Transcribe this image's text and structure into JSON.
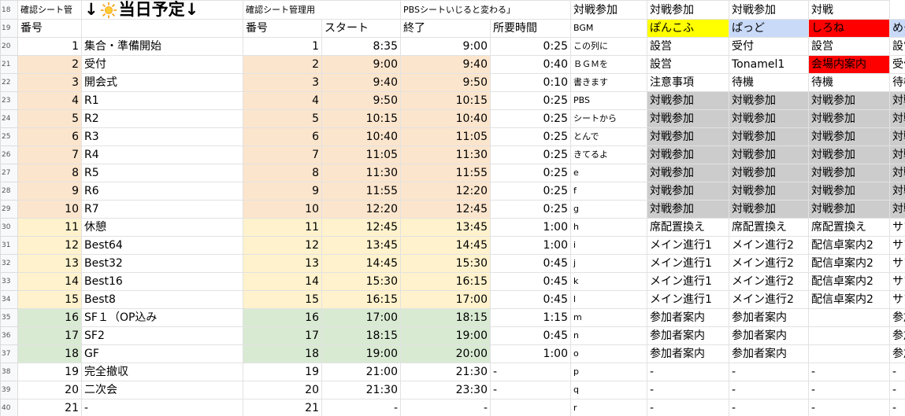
{
  "row_numbers": [
    "18",
    "19",
    "20",
    "21",
    "22",
    "23",
    "24",
    "25",
    "26",
    "27",
    "28",
    "29",
    "30",
    "31",
    "32",
    "33",
    "34",
    "35",
    "36",
    "37",
    "38",
    "39",
    "40"
  ],
  "header1": {
    "a": "確認シート管",
    "title_left_arrow": "↓",
    "title_text": "当日予定",
    "title_right_arrow": "↓",
    "c": "確認シート管理用",
    "f": "PBSシートいじると変わる」",
    "h": "対戦参加",
    "i": "対戦参加",
    "j": "対戦参加",
    "k": "対戦"
  },
  "header2": {
    "a": "番号",
    "c": "番号",
    "d": "スタート",
    "e": "終了",
    "f": "所要時間",
    "g": "BGM",
    "h": "ぽんこふ",
    "i": "ぱっど",
    "j": "しろね",
    "k": "めー"
  },
  "colors": {
    "peach": "#fce5cd",
    "cream": "#fff2cc",
    "green": "#d9ead3",
    "gray": "#cccccc",
    "yellow": "#ffff00",
    "blue": "#c9daf8",
    "red": "#ff0000"
  },
  "rows": [
    {
      "no": "1",
      "name": "集合・準備開始",
      "no2": "1",
      "start": "8:35",
      "end": "9:00",
      "dur": "0:25",
      "bgm": "この列に",
      "h": "設営",
      "i": "受付",
      "j": "設営",
      "k": "設営"
    },
    {
      "no": "2",
      "name": "受付",
      "no2": "2",
      "start": "9:00",
      "end": "9:40",
      "dur": "0:40",
      "bgm": "ＢＧＭを",
      "h": "設営",
      "i": "Tonamel1",
      "j": "会場内案内",
      "k": "受付"
    },
    {
      "no": "3",
      "name": "開会式",
      "no2": "3",
      "start": "9:40",
      "end": "9:50",
      "dur": "0:10",
      "bgm": "書きます",
      "h": "注意事項",
      "i": "待機",
      "j": "待機",
      "k": "待機"
    },
    {
      "no": "4",
      "name": "R1",
      "no2": "4",
      "start": "9:50",
      "end": "10:15",
      "dur": "0:25",
      "bgm": "PBS",
      "h": "対戦参加",
      "i": "対戦参加",
      "j": "対戦参加",
      "k": "対戦"
    },
    {
      "no": "5",
      "name": "R2",
      "no2": "5",
      "start": "10:15",
      "end": "10:40",
      "dur": "0:25",
      "bgm": "シートから",
      "h": "対戦参加",
      "i": "対戦参加",
      "j": "対戦参加",
      "k": "対戦"
    },
    {
      "no": "6",
      "name": "R3",
      "no2": "6",
      "start": "10:40",
      "end": "11:05",
      "dur": "0:25",
      "bgm": "とんで",
      "h": "対戦参加",
      "i": "対戦参加",
      "j": "対戦参加",
      "k": "対戦"
    },
    {
      "no": "7",
      "name": "R4",
      "no2": "7",
      "start": "11:05",
      "end": "11:30",
      "dur": "0:25",
      "bgm": "きてるよ",
      "h": "対戦参加",
      "i": "対戦参加",
      "j": "対戦参加",
      "k": "対戦"
    },
    {
      "no": "8",
      "name": "R5",
      "no2": "8",
      "start": "11:30",
      "end": "11:55",
      "dur": "0:25",
      "bgm": "e",
      "h": "対戦参加",
      "i": "対戦参加",
      "j": "対戦参加",
      "k": "対戦"
    },
    {
      "no": "9",
      "name": "R6",
      "no2": "9",
      "start": "11:55",
      "end": "12:20",
      "dur": "0:25",
      "bgm": "f",
      "h": "対戦参加",
      "i": "対戦参加",
      "j": "対戦参加",
      "k": "対戦"
    },
    {
      "no": "10",
      "name": "R7",
      "no2": "10",
      "start": "12:20",
      "end": "12:45",
      "dur": "0:25",
      "bgm": "g",
      "h": "対戦参加",
      "i": "対戦参加",
      "j": "対戦参加",
      "k": "対戦"
    },
    {
      "no": "11",
      "name": "休憩",
      "no2": "11",
      "start": "12:45",
      "end": "13:45",
      "dur": "1:00",
      "bgm": "h",
      "h": "席配置換え",
      "i": "席配置換え",
      "j": "席配置換え",
      "k": "サブ"
    },
    {
      "no": "12",
      "name": "Best64",
      "no2": "12",
      "start": "13:45",
      "end": "14:45",
      "dur": "1:00",
      "bgm": "i",
      "h": "メイン進行1",
      "i": "メイン進行2",
      "j": "配信卓案内2",
      "k": "サブ"
    },
    {
      "no": "13",
      "name": "Best32",
      "no2": "13",
      "start": "14:45",
      "end": "15:30",
      "dur": "0:45",
      "bgm": "j",
      "h": "メイン進行1",
      "i": "メイン進行2",
      "j": "配信卓案内2",
      "k": "サブ"
    },
    {
      "no": "14",
      "name": "Best16",
      "no2": "14",
      "start": "15:30",
      "end": "16:15",
      "dur": "0:45",
      "bgm": "k",
      "h": "メイン進行1",
      "i": "メイン進行2",
      "j": "配信卓案内2",
      "k": "サブ"
    },
    {
      "no": "15",
      "name": "Best8",
      "no2": "15",
      "start": "16:15",
      "end": "17:00",
      "dur": "0:45",
      "bgm": "l",
      "h": "メイン進行1",
      "i": "メイン進行2",
      "j": "配信卓案内2",
      "k": "サブ"
    },
    {
      "no": "16",
      "name": "SF１（OP込み",
      "no2": "16",
      "start": "17:00",
      "end": "18:15",
      "dur": "1:15",
      "bgm": "m",
      "h": "参加者案内",
      "i": "参加者案内",
      "j": "",
      "k": "参加"
    },
    {
      "no": "17",
      "name": "SF2",
      "no2": "17",
      "start": "18:15",
      "end": "19:00",
      "dur": "0:45",
      "bgm": "n",
      "h": "参加者案内",
      "i": "参加者案内",
      "j": "",
      "k": "参加"
    },
    {
      "no": "18",
      "name": "GF",
      "no2": "18",
      "start": "19:00",
      "end": "20:00",
      "dur": "1:00",
      "bgm": "o",
      "h": "参加者案内",
      "i": "参加者案内",
      "j": "",
      "k": "参加"
    },
    {
      "no": "19",
      "name": "完全撤収",
      "no2": "19",
      "start": "21:00",
      "end": "21:30",
      "dur": "-",
      "bgm": "p",
      "h": "-",
      "i": "-",
      "j": "-",
      "k": "-"
    },
    {
      "no": "20",
      "name": "二次会",
      "no2": "20",
      "start": "21:30",
      "end": "23:30",
      "dur": "-",
      "bgm": "q",
      "h": "-",
      "i": "-",
      "j": "-",
      "k": "-"
    },
    {
      "no": "21",
      "name": "-",
      "no2": "21",
      "start": "-",
      "end": "-",
      "dur": "",
      "bgm": "r",
      "h": "-",
      "i": "-",
      "j": "-",
      "k": "-"
    }
  ]
}
